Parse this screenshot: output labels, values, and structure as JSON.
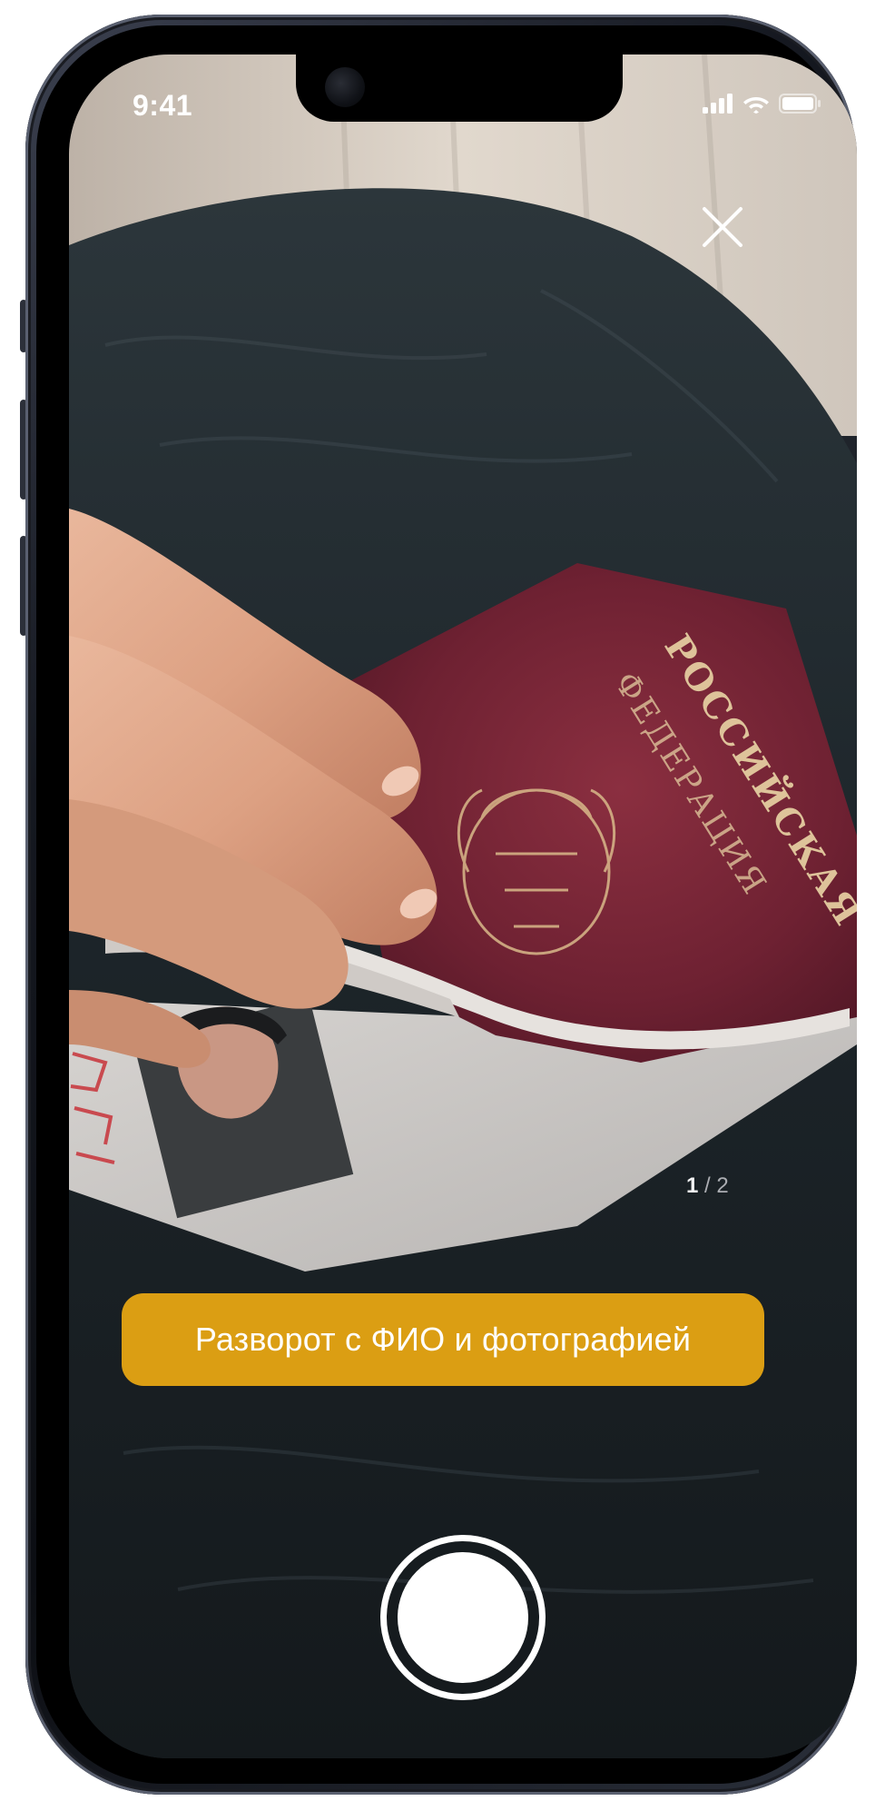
{
  "status_bar": {
    "time": "9:41",
    "icons": [
      "cellular-signal-icon",
      "wifi-icon",
      "battery-icon"
    ]
  },
  "camera": {
    "close_icon": "close-icon",
    "page_counter": {
      "current": "1",
      "separator": "/",
      "total": "2"
    },
    "hint": "Разворот с ФИО и фотографией",
    "shutter_icon": "shutter-icon"
  },
  "colors": {
    "hint_background": "#EBA812",
    "hint_text": "#FFFFFF",
    "shutter": "#FFFFFF",
    "icons": "#FFFFFF"
  }
}
